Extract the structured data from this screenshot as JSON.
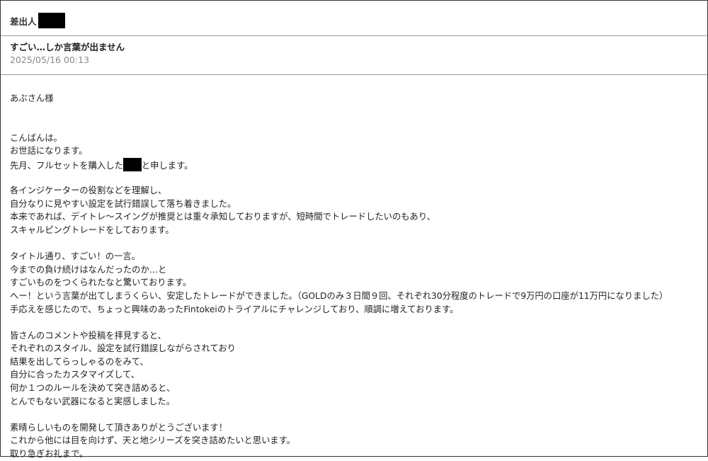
{
  "header": {
    "sender_label": "差出人",
    "subject": "すごい…しか言葉が出ません",
    "date": "2025/05/16 00:13"
  },
  "body": {
    "greeting": "あぶさん様",
    "lines": [
      "",
      "",
      "こんばんは。",
      "お世話になります。",
      "",
      "",
      "各インジケーターの役割などを理解し、",
      "自分なりに見やすい設定を試行錯誤して落ち着きました。",
      "本来であれば、デイトレ～スイングが推奨とは重々承知しておりますが、短時間でトレードしたいのもあり、",
      "スキャルピングトレードをしております。",
      "",
      "タイトル通り、すごい！の一言。",
      "今までの負け続けはなんだったのか…と",
      "すごいものをつくられたなと驚いております。",
      "へー！という言葉が出てしまうくらい、安定したトレードができました。（GOLDのみ３日間９回、それぞれ30分程度のトレードで9万円の口座が11万円になりました）",
      "手応えを感じたので、ちょっと興味のあったFintokeiのトライアルにチャレンジしており、順調に増えております。",
      "",
      "皆さんのコメントや投稿を拝見すると、",
      "それぞれのスタイル、設定を試行錯誤しながらされており",
      "結果を出してらっしゃるのをみて、",
      "自分に合ったカスタマイズして、",
      "何か１つのルールを決めて突き詰めると、",
      "とんでもない武器になると実感しました。",
      "",
      "素晴らしいものを開発して頂きありがとうございます！",
      "これから他には目を向けず、天と地シリーズを突き詰めたいと思います。",
      "取り急ぎお礼まで。"
    ],
    "purchase_line_before": "先月、フルセットを購入した",
    "purchase_line_after": "と申します。"
  },
  "colors": {
    "border": "#333333",
    "divider": "#9a9a9a",
    "date_text": "#8a8a8a",
    "redaction": "#000000"
  }
}
